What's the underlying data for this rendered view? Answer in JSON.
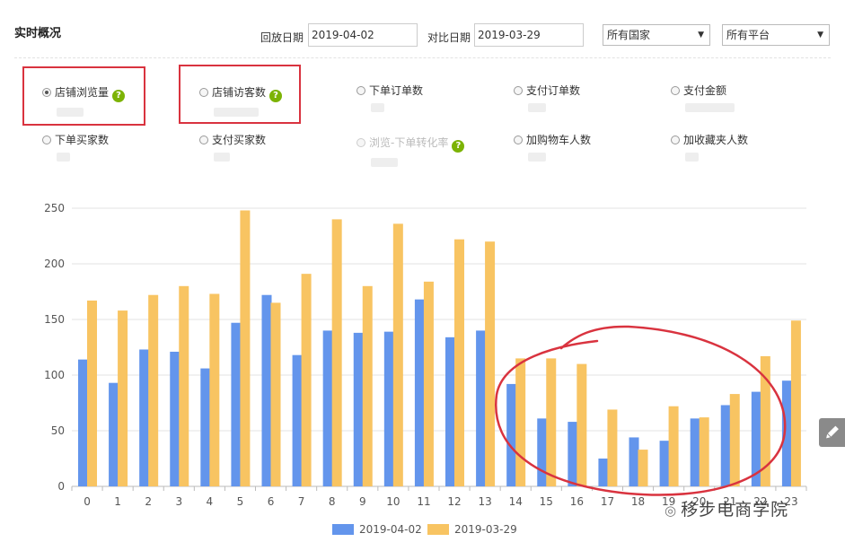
{
  "header": {
    "title": "实时概况",
    "replay_label": "回放日期",
    "replay_date": "2019-04-02",
    "compare_label": "对比日期",
    "compare_date": "2019-03-29",
    "country_select": "所有国家",
    "platform_select": "所有平台"
  },
  "metrics": [
    {
      "label": "店铺浏览量",
      "help": "?",
      "checked": true,
      "disabled": false
    },
    {
      "label": "店铺访客数",
      "help": "?",
      "checked": false,
      "disabled": false
    },
    {
      "label": "下单订单数",
      "help": "",
      "checked": false,
      "disabled": false
    },
    {
      "label": "支付订单数",
      "help": "",
      "checked": false,
      "disabled": false
    },
    {
      "label": "支付金额",
      "help": "",
      "checked": false,
      "disabled": false
    },
    {
      "label": "下单买家数",
      "help": "",
      "checked": false,
      "disabled": false
    },
    {
      "label": "支付买家数",
      "help": "",
      "checked": false,
      "disabled": false
    },
    {
      "label": "浏览-下单转化率",
      "help": "?",
      "checked": false,
      "disabled": true
    },
    {
      "label": "加购物车人数",
      "help": "",
      "checked": false,
      "disabled": false
    },
    {
      "label": "加收藏夹人数",
      "help": "",
      "checked": false,
      "disabled": false
    }
  ],
  "chart_data": {
    "type": "bar",
    "categories": [
      "0",
      "1",
      "2",
      "3",
      "4",
      "5",
      "6",
      "7",
      "8",
      "9",
      "10",
      "11",
      "12",
      "13",
      "14",
      "15",
      "16",
      "17",
      "18",
      "19",
      "20",
      "21",
      "22",
      "23"
    ],
    "series": [
      {
        "name": "2019-04-02",
        "color": "#6395ec",
        "values": [
          114,
          93,
          123,
          121,
          106,
          147,
          172,
          118,
          140,
          138,
          139,
          168,
          134,
          140,
          92,
          61,
          58,
          25,
          44,
          41,
          61,
          73,
          85,
          95
        ]
      },
      {
        "name": "2019-03-29",
        "color": "#f8c462",
        "values": [
          167,
          158,
          172,
          180,
          173,
          248,
          165,
          191,
          240,
          180,
          236,
          184,
          222,
          220,
          115,
          115,
          110,
          69,
          33,
          72,
          62,
          83,
          117,
          149
        ]
      }
    ],
    "yticks": [
      0,
      50,
      100,
      150,
      200,
      250
    ],
    "ylim": [
      0,
      250
    ],
    "grid": true,
    "legend": "bottom-center"
  },
  "watermark": {
    "icon": "wechat-icon",
    "text": "移步电商学院"
  },
  "edit_icon": "pencil-icon",
  "annotation_color": "#d9333f"
}
